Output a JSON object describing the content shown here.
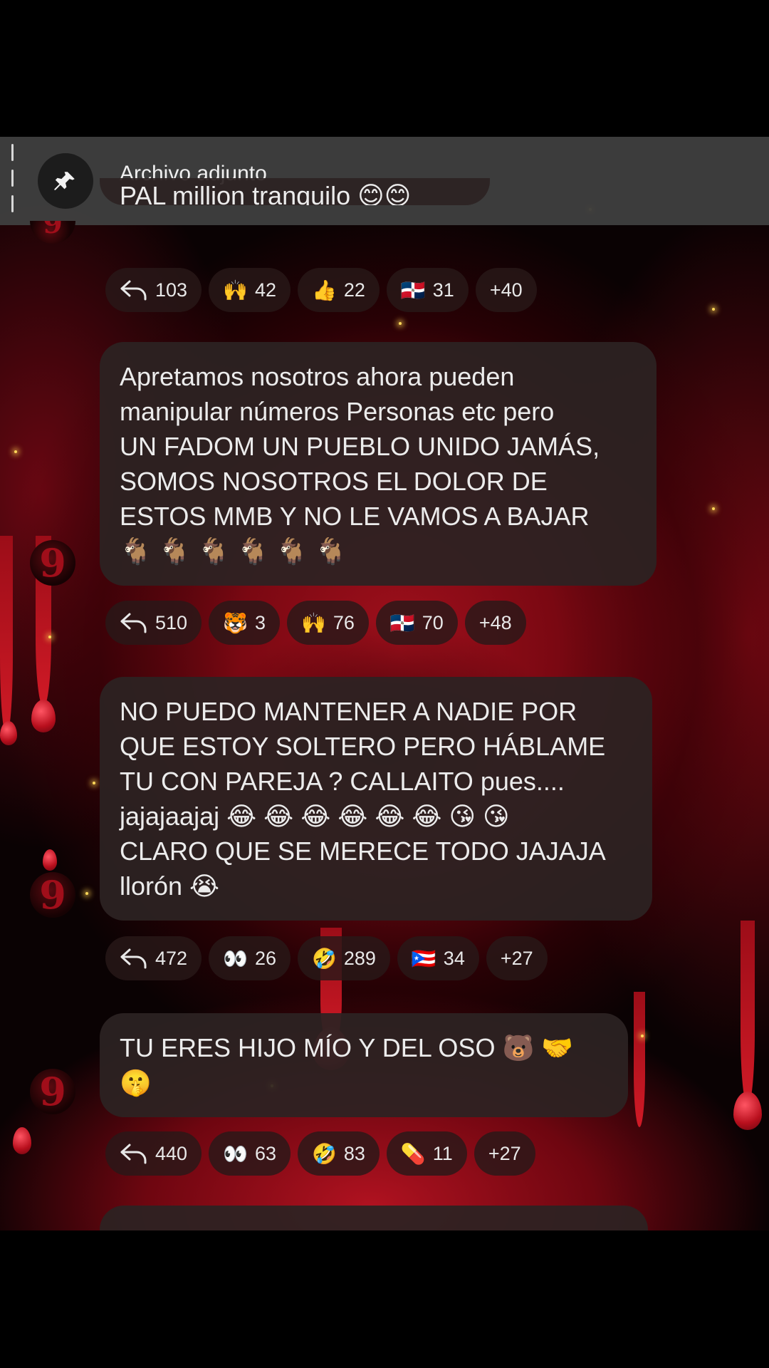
{
  "header": {
    "title": "Archivo adjunto",
    "icon": "pin-icon"
  },
  "messages": [
    {
      "lines": [
        "PAL million tranquilo 😊😊"
      ],
      "reactions": [
        {
          "icon": "reply-icon",
          "emoji": "",
          "count": "103"
        },
        {
          "icon": "raised-hands-icon",
          "emoji": "🙌",
          "count": "42"
        },
        {
          "icon": "thumbs-up-icon",
          "emoji": "👍",
          "count": "22"
        },
        {
          "icon": "flag-dominican-republic-icon",
          "emoji": "🇩🇴",
          "count": "31"
        },
        {
          "icon": "more-reactions",
          "emoji": "",
          "count": "+40"
        }
      ]
    },
    {
      "lines": [
        "Apretamos nosotros ahora pueden",
        "manipular números Personas etc pero",
        "UN FADOM UN PUEBLO UNIDO JAMÁS,",
        "SOMOS NOSOTROS EL DOLOR DE",
        "ESTOS MMB Y NO LE VAMOS A BAJAR",
        "🐐 🐐 🐐 🐐 🐐 🐐"
      ],
      "reactions": [
        {
          "icon": "reply-icon",
          "emoji": "",
          "count": "510"
        },
        {
          "icon": "tiger-face-icon",
          "emoji": "🐯",
          "count": "3"
        },
        {
          "icon": "raised-hands-icon",
          "emoji": "🙌",
          "count": "76"
        },
        {
          "icon": "flag-dominican-republic-icon",
          "emoji": "🇩🇴",
          "count": "70"
        },
        {
          "icon": "more-reactions",
          "emoji": "",
          "count": "+48"
        }
      ]
    },
    {
      "lines": [
        "NO PUEDO MANTENER A NADIE POR",
        "QUE ESTOY SOLTERO PERO HÁBLAME",
        "TU CON PAREJA ? CALLAITO pues....",
        "jajajaajaj 😂 😂 😂 😂 😂 😂 😘 😘",
        "CLARO QUE SE MERECE TODO JAJAJA",
        "llorón 😭"
      ],
      "reactions": [
        {
          "icon": "reply-icon",
          "emoji": "",
          "count": "472"
        },
        {
          "icon": "eyes-icon",
          "emoji": "👀",
          "count": "26"
        },
        {
          "icon": "rofl-icon",
          "emoji": "🤣",
          "count": "289"
        },
        {
          "icon": "flag-puerto-rico-icon",
          "emoji": "🇵🇷",
          "count": "34"
        },
        {
          "icon": "more-reactions",
          "emoji": "",
          "count": "+27"
        }
      ]
    },
    {
      "lines": [
        "TU ERES HIJO MÍO Y DEL OSO 🐻 🤝",
        "🤫"
      ],
      "reactions": [
        {
          "icon": "reply-icon",
          "emoji": "",
          "count": "440"
        },
        {
          "icon": "eyes-icon",
          "emoji": "👀",
          "count": "63"
        },
        {
          "icon": "rofl-icon",
          "emoji": "🤣",
          "count": "83"
        },
        {
          "icon": "pill-icon",
          "emoji": "💊",
          "count": "11"
        },
        {
          "icon": "more-reactions",
          "emoji": "",
          "count": "+27"
        }
      ]
    }
  ],
  "avatar_label": "9",
  "colors": {
    "header_bg": "#3e3e3e",
    "bubble_bg": "#2c2222",
    "accent_red": "#b01220"
  }
}
